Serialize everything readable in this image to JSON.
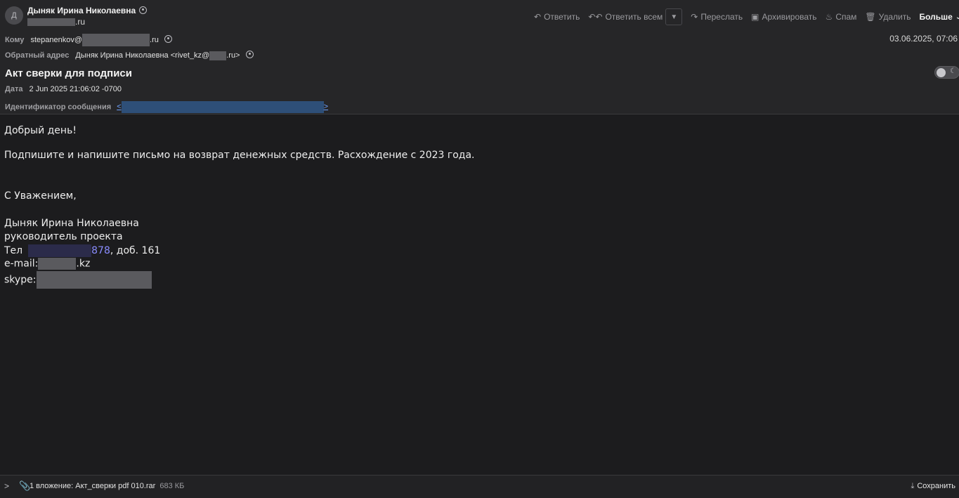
{
  "header": {
    "avatar_initial": "Д",
    "sender_name": "Дыняк Ирина Николаевна",
    "sender_email_suffix": ".ru",
    "to_label": "Кому",
    "to_prefix": "stepanenkov@",
    "to_suffix": ".ru",
    "reply_to_label": "Обратный адрес",
    "reply_to_prefix": "Дыняк Ирина Николаевна <rivet_kz@",
    "reply_to_suffix": ".ru>",
    "date_right": "03.06.2025, 07:06",
    "subject": "Акт сверки для подписи",
    "date_label": "Дата",
    "date_value": "2 Jun 2025 21:06:02 -0700",
    "msgid_label": "Идентификатор сообщения",
    "msgid_lt": "<",
    "msgid_gt": ">"
  },
  "toolbar": {
    "reply": "Ответить",
    "reply_all": "Ответить всем",
    "forward": "Переслать",
    "archive": "Архивировать",
    "spam": "Спам",
    "delete": "Удалить",
    "more": "Больше"
  },
  "icons": {
    "reply": "reply-icon",
    "reply_all": "reply-all-icon",
    "forward": "forward-icon",
    "archive": "archive-icon",
    "spam": "flame-icon",
    "delete": "trash-icon",
    "chevron_down": "chevron-down-icon",
    "attachment": "paperclip-icon",
    "save": "download-icon"
  },
  "body": {
    "greeting": "Добрый день!",
    "line1": "Подпишите и напишите письмо на возврат денежных средств. Расхождение с 2023 года.",
    "closing": "С Уважением,",
    "sig_name": "Дыняк Ирина Николаевна",
    "sig_title": "руководитель проекта",
    "tel_label": "Тел",
    "tel_visible": "878",
    "tel_ext": ", доб. 161",
    "email_label": "e-mail:",
    "email_suffix": ".kz",
    "skype_label": "skype:"
  },
  "footer": {
    "attachment": "1 вложение: Акт_сверки pdf 010.rar",
    "size": "683 КБ",
    "save": "Сохранить"
  },
  "colors": {
    "background": "#1c1c1e",
    "header_bg": "#262628",
    "link": "#6ea2ff",
    "phone_link": "#8a8cff"
  }
}
